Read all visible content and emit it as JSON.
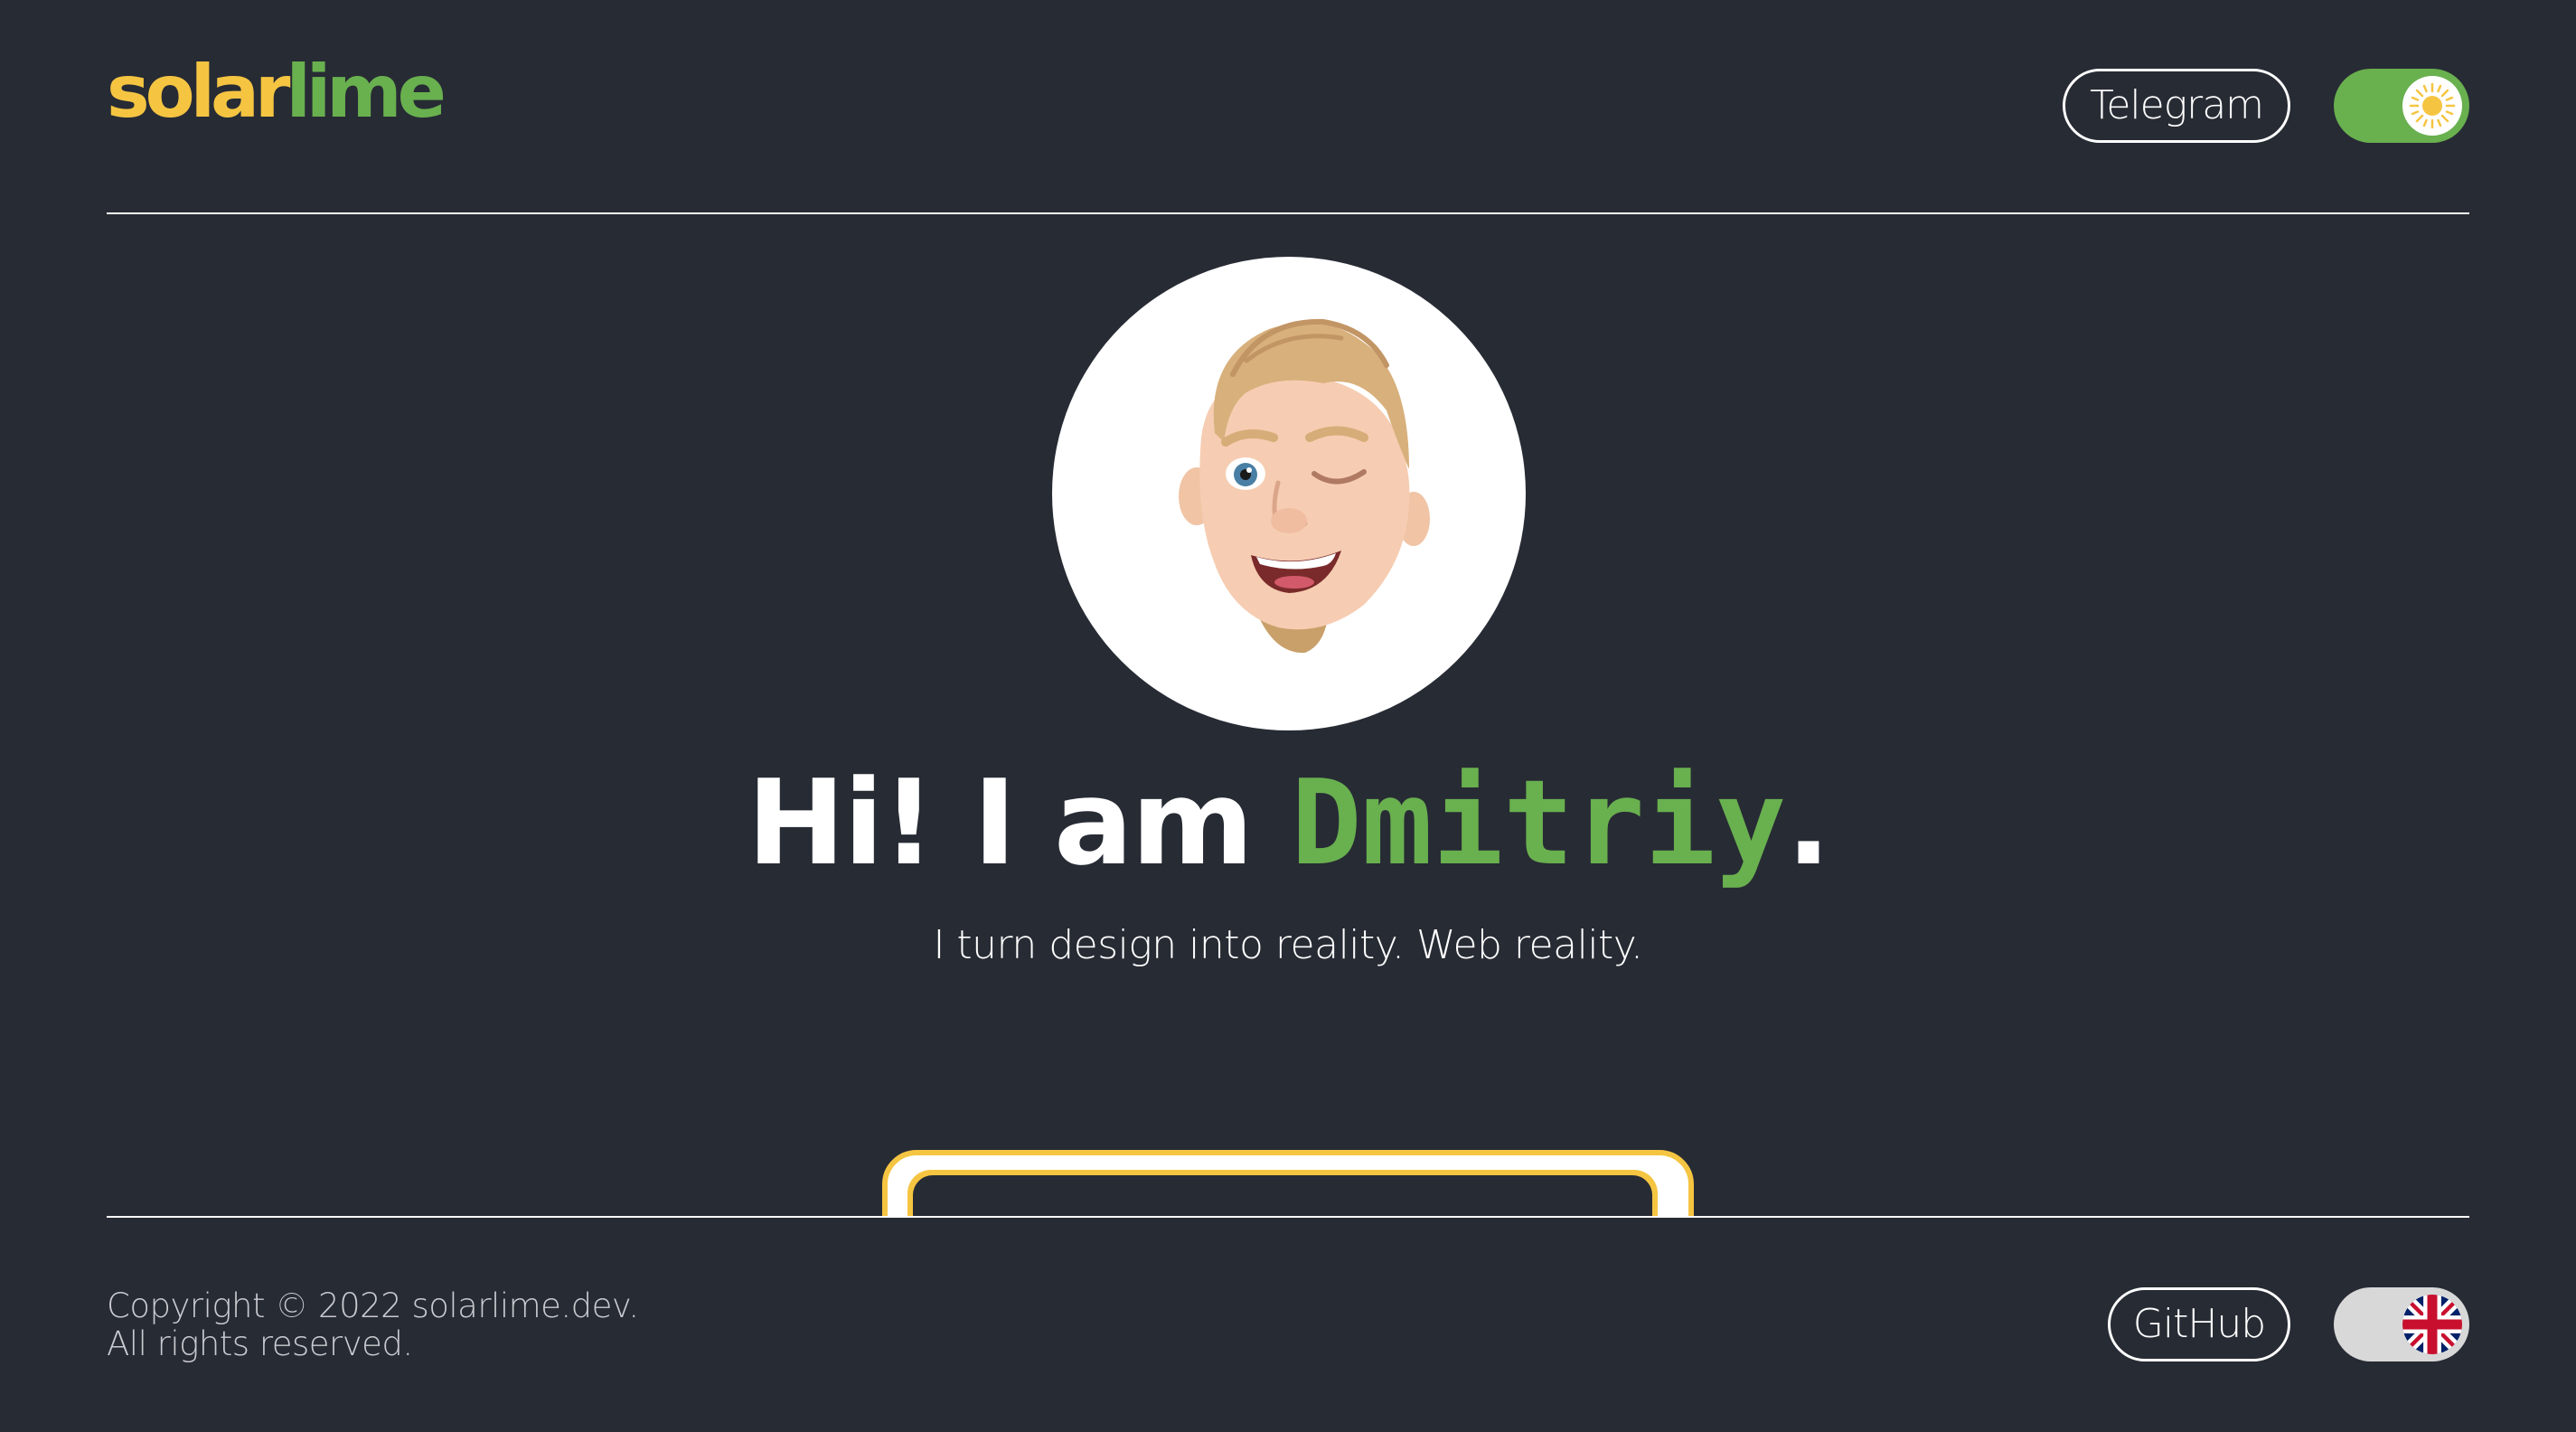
{
  "header": {
    "logo_part1": "solar",
    "logo_part2": "lime",
    "telegram_label": "Telegram",
    "theme_toggle_state": "light",
    "theme_toggle_icon": "sun-icon"
  },
  "hero": {
    "avatar_icon": "memoji-avatar",
    "greeting": "Hi! I am ",
    "name": "Dmitriy",
    "punctuation": ".",
    "subtitle": "I turn design into reality. Web reality."
  },
  "footer": {
    "copyright_line1": "Copyright © 2022 solarlime.dev.",
    "copyright_line2": "All rights reserved.",
    "github_label": "GitHub",
    "language_icon": "uk-flag-icon"
  },
  "colors": {
    "background": "#272b34",
    "accent_yellow": "#f5c542",
    "accent_green": "#69b04f",
    "text": "#ffffff"
  }
}
